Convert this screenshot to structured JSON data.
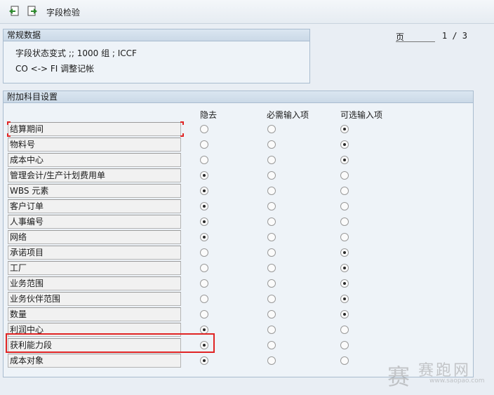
{
  "toolbar": {
    "title": "字段检验",
    "icons": [
      "back-page-icon",
      "forward-page-icon"
    ]
  },
  "page_info": {
    "label": "页",
    "value": "1 / 3"
  },
  "general": {
    "header": "常规数据",
    "line1": "字段状态变式 ;; 1000    组 ; ICCF",
    "line2": "CO <-> FI 调整记帐"
  },
  "additional": {
    "header": "附加科目设置",
    "columns": {
      "hide": "隐去",
      "required": "必需输入项",
      "optional": "可选输入项"
    },
    "rows": [
      {
        "label": "结算期间",
        "selected": "optional"
      },
      {
        "label": "物料号",
        "selected": "optional"
      },
      {
        "label": "成本中心",
        "selected": "optional"
      },
      {
        "label": "管理会计/生产计划费用单",
        "selected": "hide"
      },
      {
        "label": "WBS 元素",
        "selected": "hide"
      },
      {
        "label": "客户订单",
        "selected": "hide"
      },
      {
        "label": "人事编号",
        "selected": "hide"
      },
      {
        "label": "网络",
        "selected": "hide"
      },
      {
        "label": "承诺项目",
        "selected": "optional"
      },
      {
        "label": "工厂",
        "selected": "optional"
      },
      {
        "label": "业务范围",
        "selected": "optional"
      },
      {
        "label": "业务伙伴范围",
        "selected": "optional"
      },
      {
        "label": "数量",
        "selected": "optional"
      },
      {
        "label": "利润中心",
        "selected": "hide"
      },
      {
        "label": "获利能力段",
        "selected": "hide"
      },
      {
        "label": "成本对象",
        "selected": "hide"
      }
    ]
  },
  "watermark": {
    "logo": "赛",
    "name": "赛跑网",
    "url": "www.saopao.com"
  }
}
